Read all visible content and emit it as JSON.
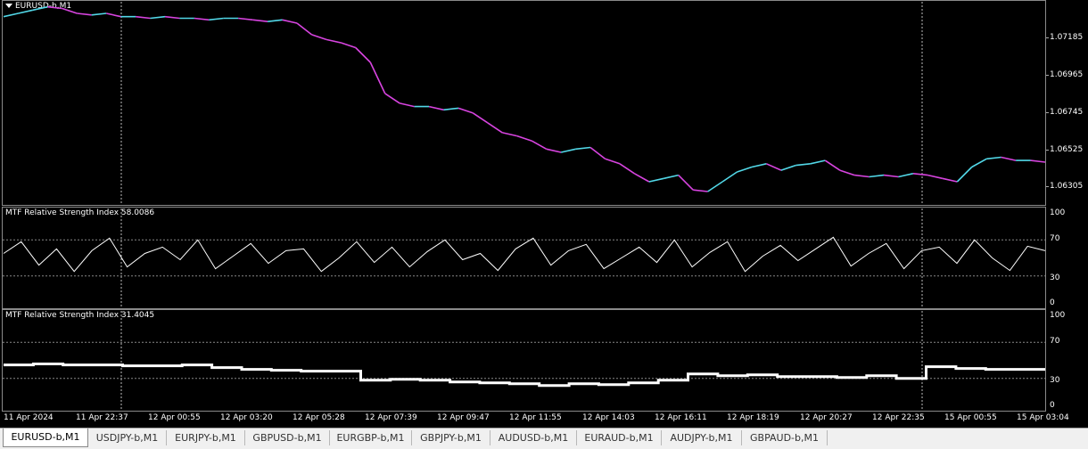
{
  "main_pane": {
    "title": "EURUSD-b,M1",
    "price_labels": [
      "1.07185",
      "1.06965",
      "1.06745",
      "1.06525",
      "1.06305"
    ],
    "colors": {
      "bull": "#52d8e8",
      "bear": "#d844e0",
      "background": "#000000"
    }
  },
  "rsi_pane_1": {
    "title": "MTF Relative Strength Index 58.0086",
    "levels": [
      "100",
      "70",
      "30",
      "0"
    ]
  },
  "rsi_pane_2": {
    "title": "MTF Relative Strength Index 31.4045",
    "levels": [
      "100",
      "70",
      "30",
      "0"
    ]
  },
  "time_axis": {
    "labels": [
      "11 Apr 2024",
      "11 Apr 22:37",
      "12 Apr 00:55",
      "12 Apr 03:20",
      "12 Apr 05:28",
      "12 Apr 07:39",
      "12 Apr 09:47",
      "12 Apr 11:55",
      "12 Apr 14:03",
      "12 Apr 16:11",
      "12 Apr 18:19",
      "12 Apr 20:27",
      "12 Apr 22:35",
      "15 Apr 00:55",
      "15 Apr 03:04"
    ]
  },
  "tabs": [
    {
      "label": "EURUSD-b,M1",
      "active": true
    },
    {
      "label": "USDJPY-b,M1",
      "active": false
    },
    {
      "label": "EURJPY-b,M1",
      "active": false
    },
    {
      "label": "GBPUSD-b,M1",
      "active": false
    },
    {
      "label": "EURGBP-b,M1",
      "active": false
    },
    {
      "label": "GBPJPY-b,M1",
      "active": false
    },
    {
      "label": "AUDUSD-b,M1",
      "active": false
    },
    {
      "label": "EURAUD-b,M1",
      "active": false
    },
    {
      "label": "AUDJPY-b,M1",
      "active": false
    },
    {
      "label": "GBPAUD-b,M1",
      "active": false
    }
  ],
  "chart_data": [
    {
      "type": "line",
      "series": [
        {
          "name": "EURUSD-b,M1",
          "values": [
            1.0737,
            1.0739,
            1.0741,
            1.0743,
            1.0742,
            1.0739,
            1.0738,
            1.0739,
            1.0737,
            1.0737,
            1.0736,
            1.0737,
            1.0736,
            1.0736,
            1.0735,
            1.0736,
            1.0736,
            1.0735,
            1.0734,
            1.0735,
            1.0733,
            1.0726,
            1.0723,
            1.0721,
            1.0718,
            1.0709,
            1.069,
            1.0684,
            1.0682,
            1.0682,
            1.068,
            1.0681,
            1.0678,
            1.0672,
            1.0666,
            1.0664,
            1.0661,
            1.0656,
            1.0654,
            1.0656,
            1.0657,
            1.065,
            1.0647,
            1.0641,
            1.0636,
            1.0638,
            1.064,
            1.0631,
            1.063,
            1.0636,
            1.0642,
            1.0645,
            1.0647,
            1.0643,
            1.0646,
            1.0647,
            1.0649,
            1.0643,
            1.064,
            1.0639,
            1.064,
            1.0639,
            1.0641,
            1.064,
            1.0638,
            1.0636,
            1.0645,
            1.065,
            1.0651,
            1.0649,
            1.0649,
            1.0648
          ]
        }
      ],
      "ylim": [
        1.0624,
        1.0745
      ]
    },
    {
      "type": "line",
      "series": [
        {
          "name": "MTF Relative Strength Index",
          "values": [
            55,
            68,
            42,
            60,
            35,
            58,
            72,
            40,
            55,
            62,
            48,
            70,
            38,
            52,
            66,
            44,
            58,
            60,
            35,
            50,
            68,
            45,
            62,
            40,
            57,
            70,
            48,
            55,
            36,
            60,
            72,
            42,
            58,
            65,
            38,
            50,
            62,
            45,
            70,
            40,
            56,
            68,
            35,
            52,
            64,
            47,
            60,
            73,
            41,
            55,
            66,
            38,
            58,
            62,
            44,
            70,
            50,
            36,
            63,
            58
          ]
        }
      ],
      "ylim": [
        0,
        100
      ]
    },
    {
      "type": "line",
      "series": [
        {
          "name": "MTF Relative Strength Index",
          "values": [
            45,
            46,
            45,
            45,
            44,
            44,
            45,
            42,
            40,
            39,
            38,
            38,
            28,
            29,
            28,
            26,
            25,
            24,
            22,
            24,
            23,
            25,
            28,
            35,
            33,
            34,
            32,
            32,
            31,
            33,
            30,
            43,
            41,
            40,
            40
          ]
        }
      ],
      "ylim": [
        0,
        100
      ]
    }
  ]
}
